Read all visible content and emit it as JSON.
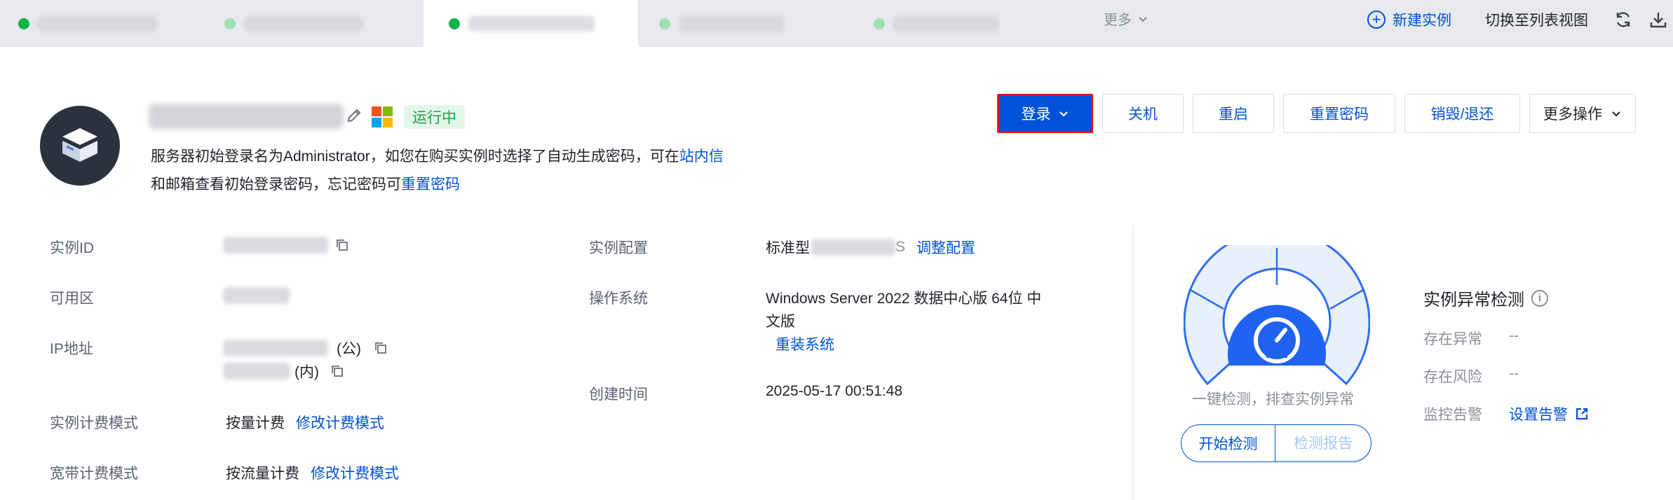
{
  "tabs": {
    "more_label": "更多",
    "new_instance_label": "新建实例",
    "switch_view_label": "切换至列表视图"
  },
  "header": {
    "status": "运行中",
    "hint_line1": "服务器初始登录名为Administrator，如您在购买实例时选择了自动生成密码，可在",
    "hint_link1": "站内信",
    "hint_line2": "和邮箱查看初始登录密码，忘记密码可",
    "hint_link2": "重置密码"
  },
  "actions": {
    "login": "登录",
    "shutdown": "关机",
    "restart": "重启",
    "reset_password": "重置密码",
    "destroy": "销毁/退还",
    "more": "更多操作"
  },
  "info_left": {
    "instance_id_label": "实例ID",
    "zone_label": "可用区",
    "ip_label": "IP地址",
    "ip_public_suffix": "(公)",
    "ip_private_suffix": "(内)",
    "billing_label": "实例计费模式",
    "billing_value": "按量计费",
    "billing_link": "修改计费模式",
    "bandwidth_label": "宽带计费模式",
    "bandwidth_value": "按流量计费",
    "bandwidth_link": "修改计费模式"
  },
  "info_mid": {
    "config_label": "实例配置",
    "config_value_prefix": "标准型",
    "config_value_suffix": "S",
    "config_link": "调整配置",
    "os_label": "操作系统",
    "os_value_line1": "Windows Server 2022 数据中心版 64位 中",
    "os_value_line2": "文版",
    "os_link": "重装系统",
    "created_label": "创建时间",
    "created_value": "2025-05-17 00:51:48"
  },
  "detection": {
    "caption": "一键检测，排查实例异常",
    "start_button": "开始检测",
    "report_button": "检测报告",
    "title": "实例异常检测",
    "abnormal_label": "存在异常",
    "abnormal_value": "--",
    "risk_label": "存在风险",
    "risk_value": "--",
    "monitor_label": "监控告警",
    "monitor_link": "设置告警"
  },
  "colors": {
    "primary": "#0052d9",
    "status_green": "#16a34a",
    "highlight_border": "#e0141e"
  }
}
